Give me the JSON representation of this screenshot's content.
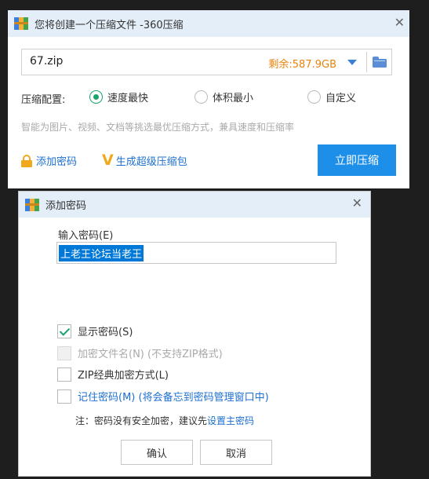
{
  "compress_dialog": {
    "title": "您将创建一个压缩文件 -360压缩",
    "close": "✕",
    "file_name": "67.zip",
    "free_space": "剩余:587.9GB",
    "config_label": "压缩配置:",
    "options": [
      {
        "label": "速度最快",
        "selected": true
      },
      {
        "label": "体积最小",
        "selected": false
      },
      {
        "label": "自定义",
        "selected": false
      }
    ],
    "description": "智能为图片、视频、文档等挑选最优压缩方式，兼具速度和压缩率",
    "add_password_link": "添加密码",
    "sfx_link": "生成超级压缩包",
    "compress_button": "立即压缩"
  },
  "password_dialog": {
    "title": "添加密码",
    "close": "✕",
    "input_label": "输入密码(E)",
    "password_value": "上老王论坛当老王",
    "options": [
      {
        "label": "显示密码(S)",
        "checked": true,
        "disabled": false
      },
      {
        "label": "加密文件名(N) (不支持ZIP格式)",
        "checked": false,
        "disabled": true
      },
      {
        "label": "ZIP经典加密方式(L)",
        "checked": false,
        "disabled": false
      },
      {
        "label": "记住密码(M) (将会备忘到密码管理窗口中)",
        "checked": false,
        "disabled": false
      }
    ],
    "note_prefix": "注：密码没有安全加密，建议先",
    "note_link": "设置主密码",
    "ok_button": "确认",
    "cancel_button": "取消"
  }
}
